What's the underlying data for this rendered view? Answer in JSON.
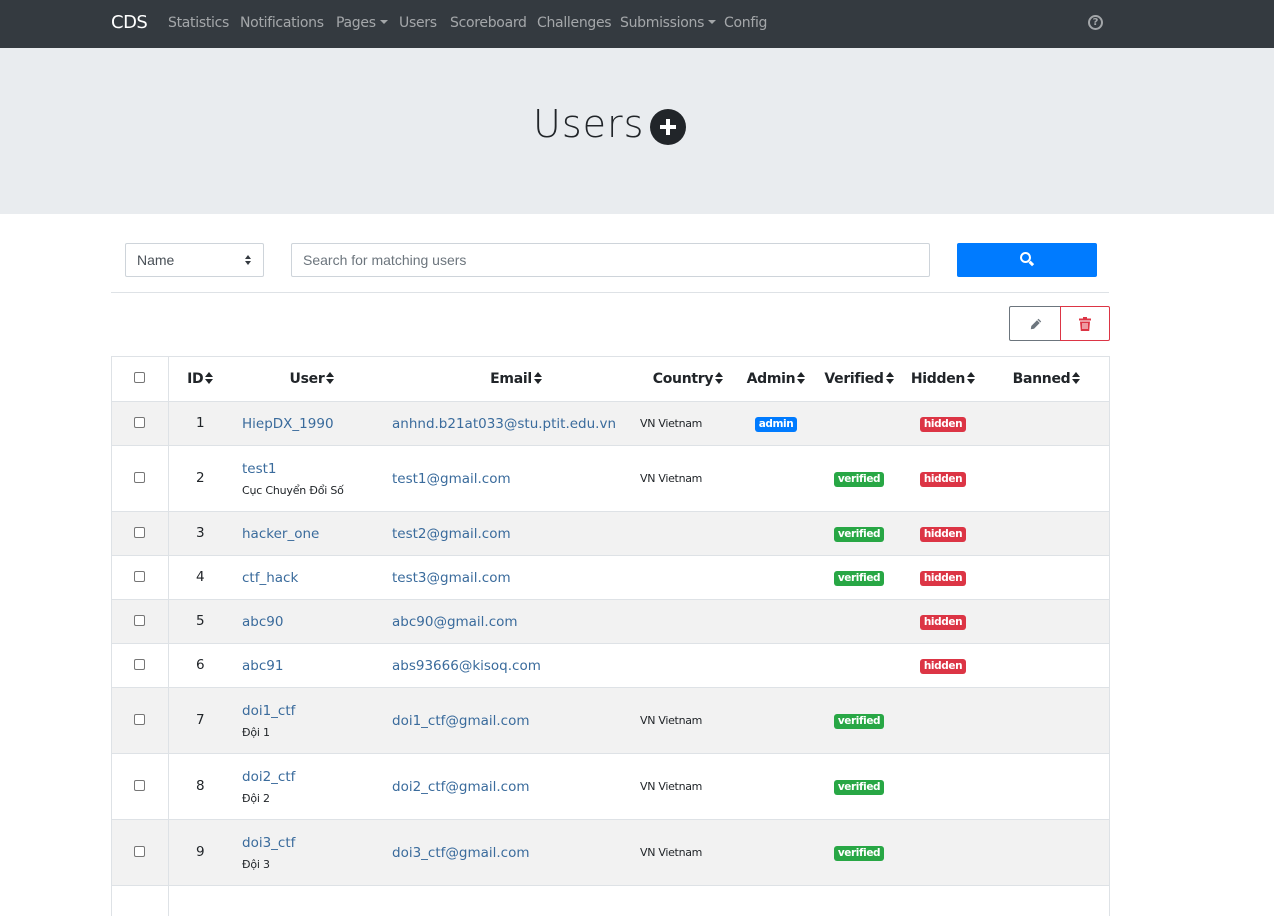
{
  "navbar": {
    "brand": "CDS",
    "items": [
      "Statistics",
      "Notifications",
      "Pages",
      "Users",
      "Scoreboard",
      "Challenges",
      "Submissions",
      "Config"
    ],
    "help_icon": "question-circle-icon"
  },
  "header": {
    "title": "Users",
    "add_icon": "plus-circle-icon"
  },
  "search": {
    "field_selected": "Name",
    "placeholder": "Search for matching users",
    "button_icon": "search-icon"
  },
  "actions": {
    "edit_icon": "pencil-icon",
    "delete_icon": "trash-icon"
  },
  "colors": {
    "admin": "#007bff",
    "verified": "#28a745",
    "hidden": "#dc3545",
    "link": "#3a6b9c",
    "navbar": "#343a40"
  },
  "table": {
    "columns": [
      "ID",
      "User",
      "Email",
      "Country",
      "Admin",
      "Verified",
      "Hidden",
      "Banned"
    ],
    "rows": [
      {
        "id": "1",
        "user": "HiepDX_1990",
        "team": "",
        "email": "anhnd.b21at033@stu.ptit.edu.vn",
        "country": "VN Vietnam",
        "admin": "admin",
        "verified": "",
        "hidden": "hidden",
        "banned": ""
      },
      {
        "id": "2",
        "user": "test1",
        "team": "Cục Chuyển Đổi Số",
        "email": "test1@gmail.com",
        "country": "VN Vietnam",
        "admin": "",
        "verified": "verified",
        "hidden": "hidden",
        "banned": ""
      },
      {
        "id": "3",
        "user": "hacker_one",
        "team": "",
        "email": "test2@gmail.com",
        "country": "",
        "admin": "",
        "verified": "verified",
        "hidden": "hidden",
        "banned": ""
      },
      {
        "id": "4",
        "user": "ctf_hack",
        "team": "",
        "email": "test3@gmail.com",
        "country": "",
        "admin": "",
        "verified": "verified",
        "hidden": "hidden",
        "banned": ""
      },
      {
        "id": "5",
        "user": "abc90",
        "team": "",
        "email": "abc90@gmail.com",
        "country": "",
        "admin": "",
        "verified": "",
        "hidden": "hidden",
        "banned": ""
      },
      {
        "id": "6",
        "user": "abc91",
        "team": "",
        "email": "abs93666@kisoq.com",
        "country": "",
        "admin": "",
        "verified": "",
        "hidden": "hidden",
        "banned": ""
      },
      {
        "id": "7",
        "user": "doi1_ctf",
        "team": "Đội 1",
        "email": "doi1_ctf@gmail.com",
        "country": "VN Vietnam",
        "admin": "",
        "verified": "verified",
        "hidden": "",
        "banned": ""
      },
      {
        "id": "8",
        "user": "doi2_ctf",
        "team": "Đội 2",
        "email": "doi2_ctf@gmail.com",
        "country": "VN Vietnam",
        "admin": "",
        "verified": "verified",
        "hidden": "",
        "banned": ""
      },
      {
        "id": "9",
        "user": "doi3_ctf",
        "team": "Đội 3",
        "email": "doi3_ctf@gmail.com",
        "country": "VN Vietnam",
        "admin": "",
        "verified": "verified",
        "hidden": "",
        "banned": ""
      }
    ]
  }
}
